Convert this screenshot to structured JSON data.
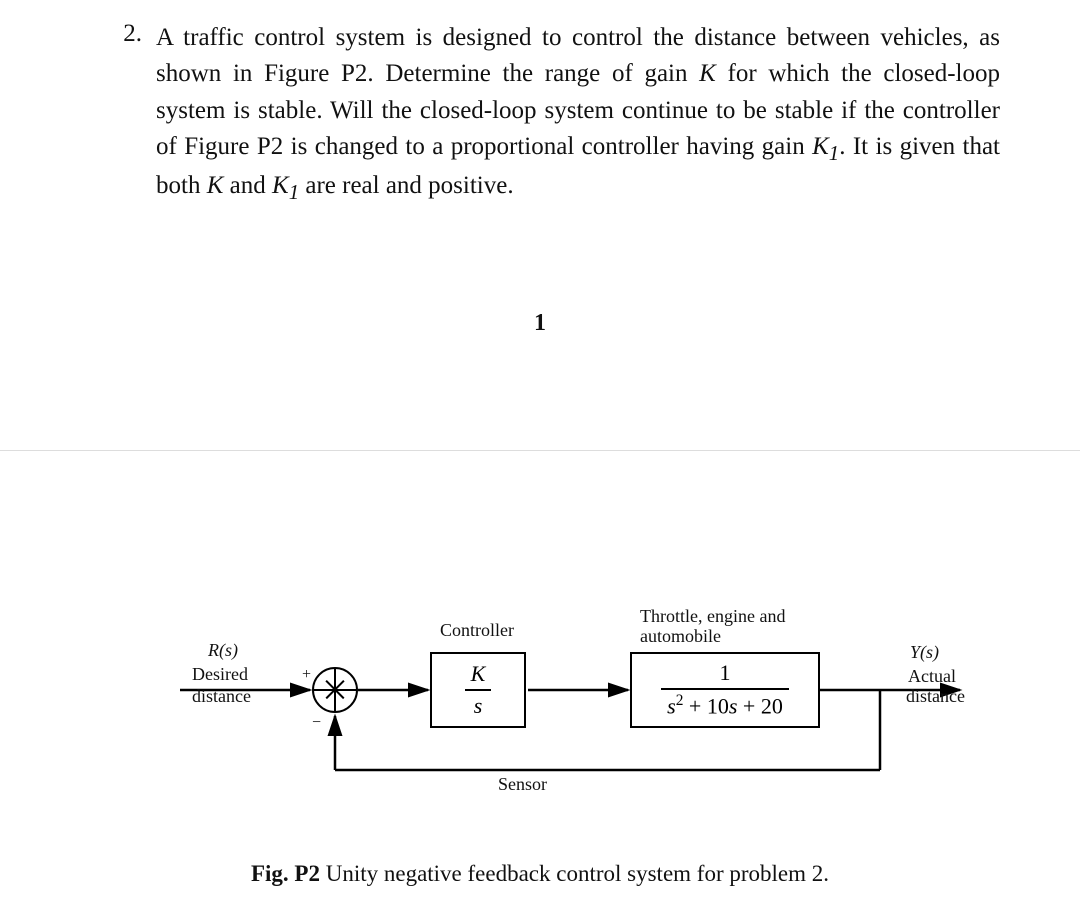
{
  "question": {
    "number": "2.",
    "text": "A traffic control system is designed to control the distance between vehicles, as shown in Figure P2. Determine the range of gain K for which the closed-loop system is stable. Will the closed-loop system continue to be stable if the controller of Figure P2 is changed to a proportional controller having gain K₁. It is given that both K and K₁ are real and positive."
  },
  "page_number": "1",
  "diagram": {
    "input_label_signal": "R(s)",
    "input_label_line1": "Desired",
    "input_label_line2": "distance",
    "sum_plus": "+",
    "sum_minus": "−",
    "controller_label": "Controller",
    "controller_tf_num": "K",
    "controller_tf_den": "s",
    "plant_label": "Throttle, engine and",
    "plant_label2": "automobile",
    "plant_tf_num": "1",
    "plant_tf_den": "s² + 10s + 20",
    "output_label_signal": "Y(s)",
    "output_label_line1": "Actual",
    "output_label_line2": "distance",
    "sensor_label": "Sensor"
  },
  "caption": {
    "bold": "Fig. P2",
    "rest": " Unity negative feedback control system for problem 2."
  }
}
